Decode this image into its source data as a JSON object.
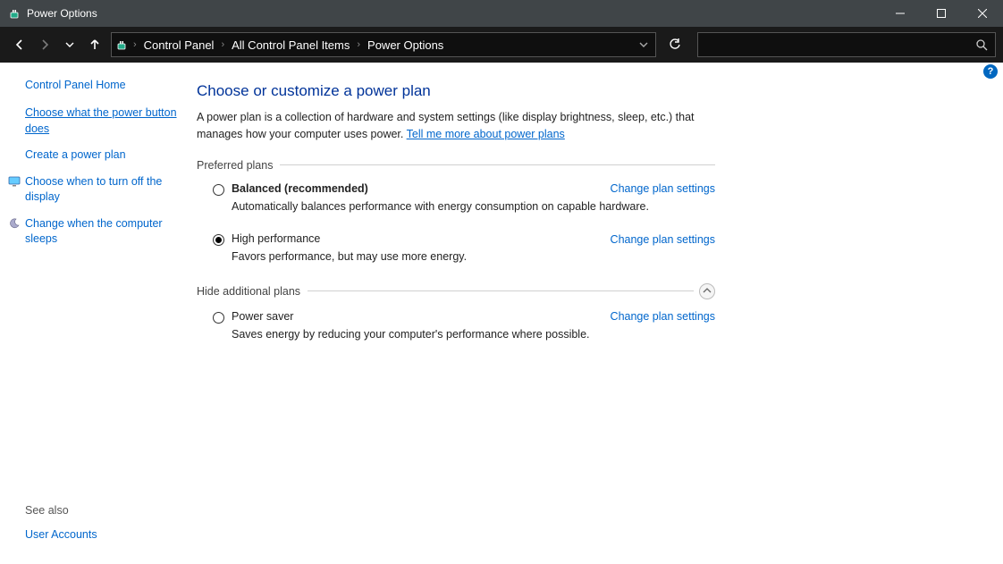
{
  "window": {
    "title": "Power Options"
  },
  "breadcrumb": {
    "items": [
      "Control Panel",
      "All Control Panel Items",
      "Power Options"
    ]
  },
  "sidebar": {
    "home": "Control Panel Home",
    "links": [
      {
        "label": "Choose what the power button does",
        "active": true,
        "icon": null
      },
      {
        "label": "Create a power plan",
        "active": false,
        "icon": null
      },
      {
        "label": "Choose when to turn off the display",
        "active": false,
        "icon": "display"
      },
      {
        "label": "Change when the computer sleeps",
        "active": false,
        "icon": "moon"
      }
    ],
    "see_also_label": "See also",
    "see_also_links": [
      "User Accounts"
    ]
  },
  "main": {
    "heading": "Choose or customize a power plan",
    "intro_text": "A power plan is a collection of hardware and system settings (like display brightness, sleep, etc.) that manages how your computer uses power. ",
    "intro_link": "Tell me more about power plans",
    "preferred_label": "Preferred plans",
    "additional_label": "Hide additional plans",
    "change_link": "Change plan settings",
    "preferred_plans": [
      {
        "name": "Balanced (recommended)",
        "desc": "Automatically balances performance with energy consumption on capable hardware.",
        "selected": false
      },
      {
        "name": "High performance",
        "desc": "Favors performance, but may use more energy.",
        "selected": true
      }
    ],
    "additional_plans": [
      {
        "name": "Power saver",
        "desc": "Saves energy by reducing your computer's performance where possible.",
        "selected": false
      }
    ]
  }
}
